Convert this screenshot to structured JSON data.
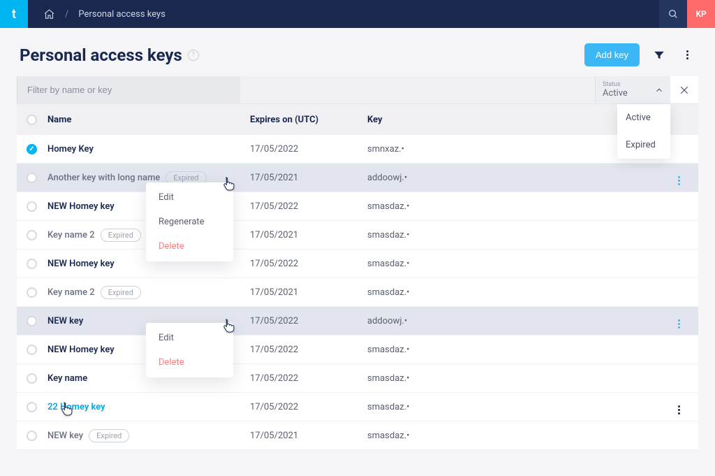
{
  "topbar": {
    "logo_letter": "t",
    "breadcrumb_slash": "/",
    "breadcrumb_page": "Personal access keys",
    "avatar_initials": "KP"
  },
  "page": {
    "title": "Personal access keys"
  },
  "actions": {
    "add_key": "Add key"
  },
  "filter": {
    "placeholder": "Filter by name or key",
    "status_label": "Status",
    "status_value": "Active",
    "status_options": [
      "Active",
      "Expired"
    ]
  },
  "columns": {
    "name": "Name",
    "expires": "Expires on (UTC)",
    "key": "Key"
  },
  "badge_expired": "Expired",
  "rows": [
    {
      "name": "Homey Key",
      "expires": "17/05/2022",
      "key": "smnxaz.•",
      "checked": true
    },
    {
      "name": "Another key with long name",
      "expires": "17/05/2021",
      "key": "addoowj.•",
      "badge": true
    },
    {
      "name": "NEW Homey key",
      "expires": "17/05/2022",
      "key": "smasdaz.•"
    },
    {
      "name": "Key name 2",
      "expires": "17/05/2021",
      "key": "smasdaz.•",
      "badge": true
    },
    {
      "name": "NEW Homey key",
      "expires": "17/05/2022",
      "key": "smasdaz.•"
    },
    {
      "name": "Key name 2",
      "expires": "17/05/2021",
      "key": "smasdaz.•",
      "badge": true
    },
    {
      "name": "NEW key",
      "expires": "17/05/2022",
      "key": "addoowj.•"
    },
    {
      "name": "NEW Homey key",
      "expires": "17/05/2022",
      "key": "smasdaz.•"
    },
    {
      "name": "Key name",
      "expires": "17/05/2022",
      "key": "smasdaz.•"
    },
    {
      "name": "22 Homey key",
      "expires": "17/05/2022",
      "key": "smasdaz.•"
    },
    {
      "name": "NEW key",
      "expires": "17/05/2021",
      "key": "smasdaz.•",
      "badge": true
    }
  ],
  "context_menu_1": [
    "Edit",
    "Regenerate",
    "Delete"
  ],
  "context_menu_2": [
    "Edit",
    "Delete"
  ]
}
